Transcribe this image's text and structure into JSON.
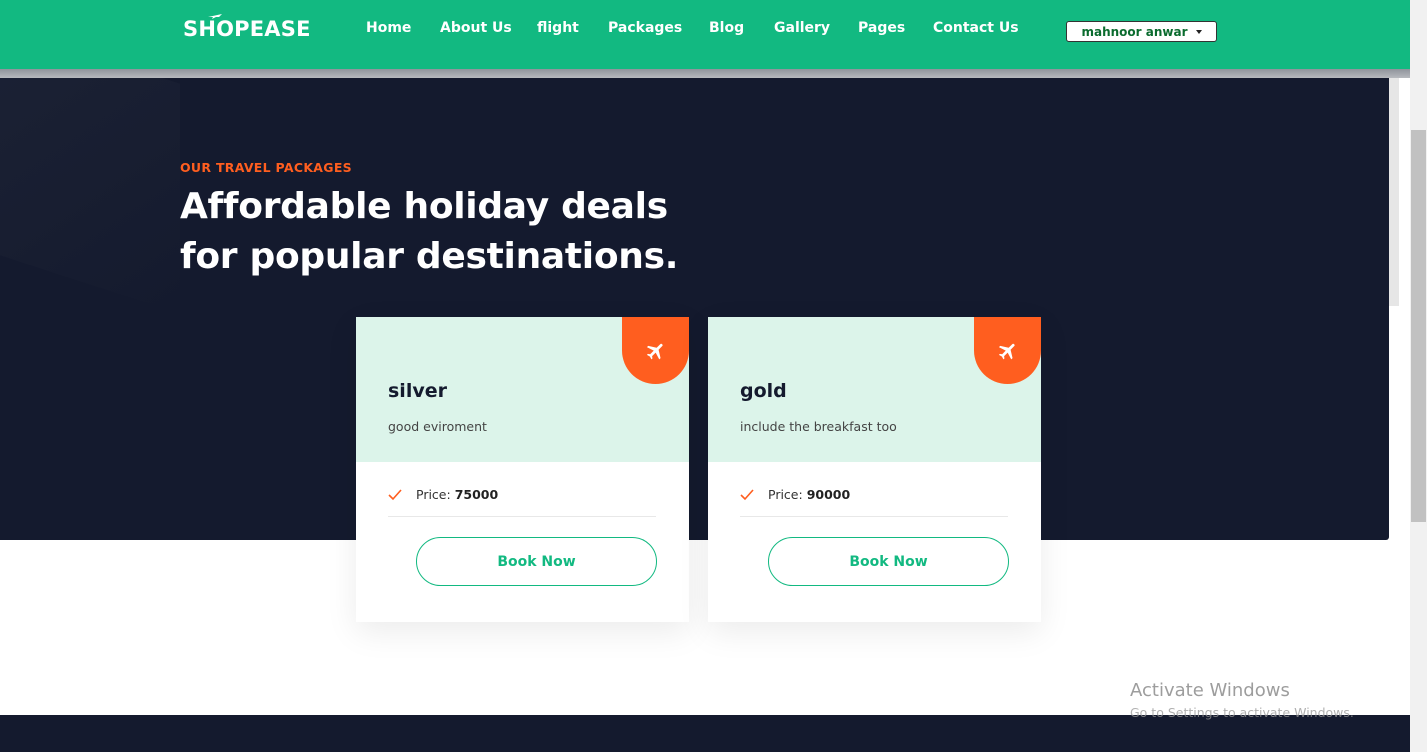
{
  "brand": {
    "logo_text": "SHOPEASE"
  },
  "nav": {
    "items": [
      {
        "label": "Home"
      },
      {
        "label": "About Us"
      },
      {
        "label": "flight"
      },
      {
        "label": "Packages"
      },
      {
        "label": "Blog"
      },
      {
        "label": "Gallery"
      },
      {
        "label": "Pages"
      },
      {
        "label": "Contact Us"
      }
    ],
    "user_menu_label": "mahnoor anwar"
  },
  "hero": {
    "eyebrow": "OUR TRAVEL PACKAGES",
    "heading_line1": "Affordable holiday deals",
    "heading_line2": "for popular destinations."
  },
  "packages": [
    {
      "name": "silver",
      "description": "good eviroment",
      "price_label": "Price:",
      "price_value": "75000",
      "button_label": "Book Now"
    },
    {
      "name": "gold",
      "description": "include the breakfast too",
      "price_label": "Price:",
      "price_value": "90000",
      "button_label": "Book Now"
    }
  ],
  "watermark": {
    "title": "Activate Windows",
    "subtitle": "Go to Settings to activate Windows."
  },
  "colors": {
    "primary_green": "#12b981",
    "accent_orange": "#ff5e1f",
    "navy": "#141a2e",
    "card_mint": "#dcf4ea"
  },
  "icons": {
    "package_badge": "airplane-icon",
    "price_bullet": "check-icon",
    "user_menu": "chevron-down-icon"
  }
}
